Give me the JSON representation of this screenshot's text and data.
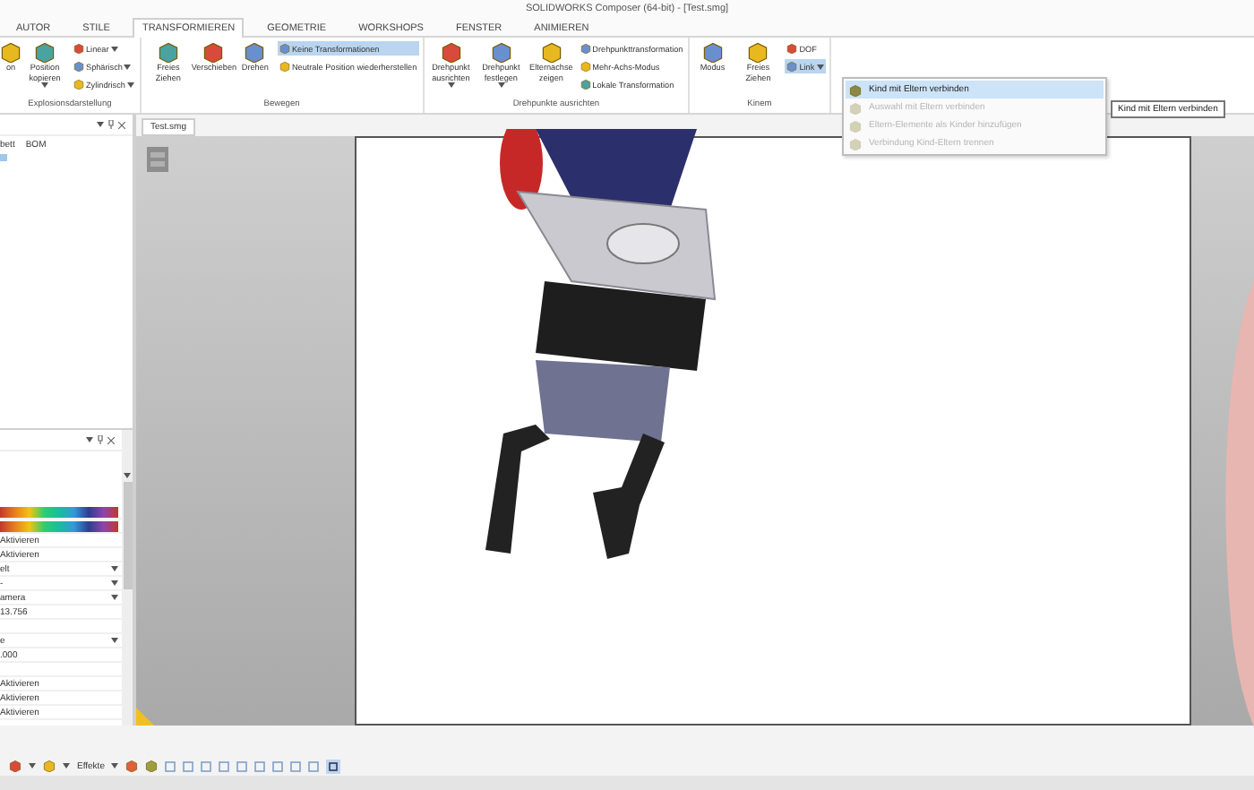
{
  "window": {
    "title": "SOLIDWORKS Composer (64-bit) - [Test.smg]"
  },
  "tabs": [
    {
      "label": "AUTOR",
      "selected": false
    },
    {
      "label": "STILE",
      "selected": false
    },
    {
      "label": "TRANSFORMIEREN",
      "selected": true
    },
    {
      "label": "GEOMETRIE",
      "selected": false
    },
    {
      "label": "WORKSHOPS",
      "selected": false
    },
    {
      "label": "FENSTER",
      "selected": false
    },
    {
      "label": "ANIMIEREN",
      "selected": false
    }
  ],
  "ribbon": {
    "groups": [
      {
        "label": "Explosionsdarstellung",
        "columns": [
          [
            {
              "kind": "large",
              "label": "on",
              "dropdown": false,
              "highlighted": false
            }
          ],
          [
            {
              "kind": "large",
              "label": "Position kopieren",
              "dropdown": true,
              "highlighted": false
            }
          ],
          [
            {
              "kind": "small",
              "label": "Linear",
              "dropdown": true,
              "highlighted": false
            },
            {
              "kind": "small",
              "label": "Sphärisch",
              "dropdown": true,
              "highlighted": false
            },
            {
              "kind": "small",
              "label": "Zylindrisch",
              "dropdown": true,
              "highlighted": false
            }
          ]
        ]
      },
      {
        "label": "Bewegen",
        "columns": [
          [
            {
              "kind": "large",
              "label": "Freies Ziehen",
              "dropdown": false,
              "highlighted": false
            }
          ],
          [
            {
              "kind": "large",
              "label": "Verschieben",
              "dropdown": false,
              "highlighted": false
            }
          ],
          [
            {
              "kind": "large",
              "label": "Drehen",
              "dropdown": false,
              "highlighted": false
            }
          ],
          [
            {
              "kind": "small",
              "label": "Keine Transformationen",
              "dropdown": false,
              "highlighted": true
            },
            {
              "kind": "small",
              "label": "Neutrale Position wiederherstellen",
              "dropdown": false,
              "highlighted": false
            }
          ]
        ]
      },
      {
        "label": "Drehpunkte ausrichten",
        "columns": [
          [
            {
              "kind": "large",
              "label": "Drehpunkt ausrichten",
              "dropdown": true,
              "highlighted": false
            }
          ],
          [
            {
              "kind": "large",
              "label": "Drehpunkt festlegen",
              "dropdown": true,
              "highlighted": false
            }
          ],
          [
            {
              "kind": "large",
              "label": "Elternachse zeigen",
              "dropdown": false,
              "highlighted": false
            }
          ],
          [
            {
              "kind": "small",
              "label": "Drehpunkttransformation",
              "dropdown": false,
              "highlighted": false
            },
            {
              "kind": "small",
              "label": "Mehr-Achs-Modus",
              "dropdown": false,
              "highlighted": false
            },
            {
              "kind": "small",
              "label": "Lokale Transformation",
              "dropdown": false,
              "highlighted": false
            }
          ]
        ]
      },
      {
        "label": "Kinem",
        "columns": [
          [
            {
              "kind": "large",
              "label": "Modus",
              "dropdown": false,
              "highlighted": false
            }
          ],
          [
            {
              "kind": "large",
              "label": "Freies Ziehen",
              "dropdown": false,
              "highlighted": false
            }
          ],
          [
            {
              "kind": "small",
              "label": "DOF",
              "dropdown": false,
              "highlighted": false
            },
            {
              "kind": "small",
              "label": "Link",
              "dropdown": true,
              "highlighted": true
            }
          ]
        ]
      }
    ]
  },
  "left_panel": {
    "tabs": [
      "bett",
      "BOM"
    ],
    "properties": [
      {
        "kind": "gradient"
      },
      {
        "kind": "gradient"
      },
      {
        "kind": "text",
        "value": "Aktivieren"
      },
      {
        "kind": "text",
        "value": "Aktivieren"
      },
      {
        "kind": "dropdown",
        "value": "elt"
      },
      {
        "kind": "dropdown",
        "value": "-"
      },
      {
        "kind": "dropdown",
        "value": "amera"
      },
      {
        "kind": "text",
        "value": "13.756"
      },
      {
        "kind": "blank"
      },
      {
        "kind": "dropdown",
        "value": "e"
      },
      {
        "kind": "text",
        "value": ".000"
      },
      {
        "kind": "blank"
      },
      {
        "kind": "text",
        "value": "Aktivieren"
      },
      {
        "kind": "text",
        "value": "Aktivieren"
      },
      {
        "kind": "text",
        "value": "Aktivieren"
      }
    ]
  },
  "document_tab": "Test.smg",
  "link_menu": {
    "items": [
      {
        "label": "Kind mit Eltern verbinden",
        "disabled": false,
        "highlighted": true
      },
      {
        "label": "Auswahl mit Eltern verbinden",
        "disabled": true,
        "highlighted": false
      },
      {
        "label": "Eltern-Elemente als Kinder hinzufügen",
        "disabled": true,
        "highlighted": false
      },
      {
        "label": "Verbindung Kind-Eltern trennen",
        "disabled": true,
        "highlighted": false
      }
    ],
    "tooltip": "Kind mit Eltern verbinden"
  },
  "bottom_toolbar": {
    "label": "Effekte"
  }
}
